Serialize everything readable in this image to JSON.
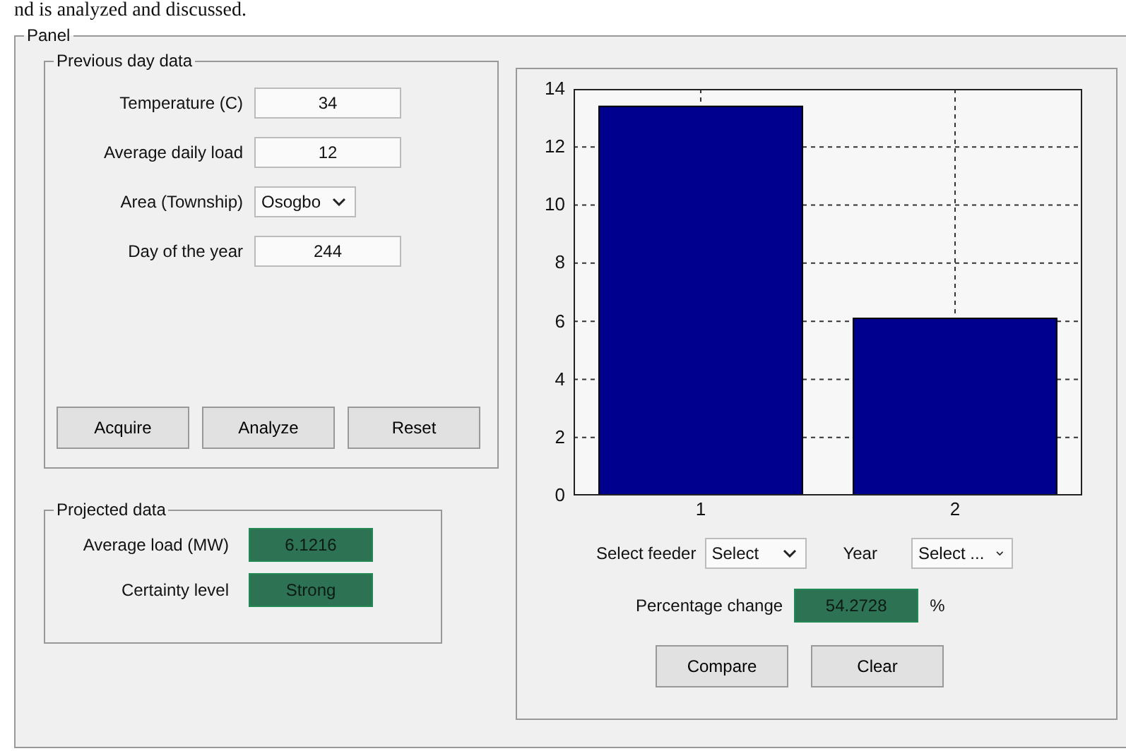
{
  "document_text": "nd is analyzed and discussed.",
  "panel": {
    "title": "Panel",
    "previous_day": {
      "title": "Previous day data",
      "fields": [
        {
          "kind": "input",
          "label": "Temperature (C)",
          "value": "34"
        },
        {
          "kind": "input",
          "label": "Average daily load",
          "value": "12"
        },
        {
          "kind": "dropdown",
          "label": "Area (Township)",
          "value": "Osogbo"
        },
        {
          "kind": "input",
          "label": "Day of the year",
          "value": "244"
        }
      ],
      "buttons": [
        "Acquire",
        "Analyze",
        "Reset"
      ]
    },
    "projected": {
      "title": "Projected data",
      "outputs": [
        {
          "label": "Average load (MW)",
          "value": "6.1216"
        },
        {
          "label": "Certainty level",
          "value": "Strong"
        }
      ]
    },
    "chart_data": {
      "type": "bar",
      "categories": [
        "1",
        "2"
      ],
      "values": [
        13.4,
        6.1
      ],
      "ylim": [
        0,
        14
      ],
      "grid": true,
      "yticks": [
        0,
        2,
        4,
        6,
        8,
        10,
        12,
        14
      ]
    },
    "feeder": {
      "label": "Select feeder",
      "value": "Select"
    },
    "year": {
      "label": "Year",
      "value": "Select ..."
    },
    "percentage": {
      "label": "Percentage change",
      "value": "54.2728",
      "unit": "%"
    },
    "buttons": [
      "Compare",
      "Clear"
    ]
  }
}
